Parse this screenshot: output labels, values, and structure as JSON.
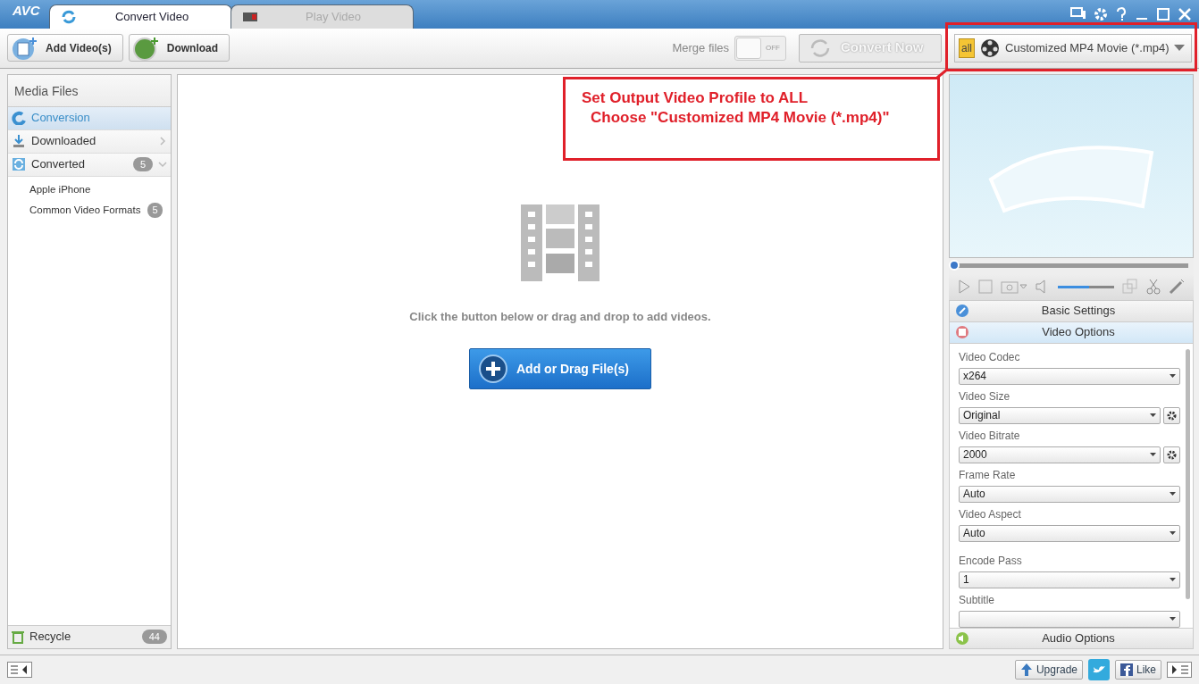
{
  "window": {
    "logo": "AVC"
  },
  "tabs": [
    {
      "label": "Convert Video",
      "selected": true
    },
    {
      "label": "Play Video",
      "selected": false
    }
  ],
  "toolbar": {
    "buttons": [
      "Add Video(s)",
      "Download"
    ],
    "merge": {
      "label": "Merge files",
      "on": false,
      "state_text": "OFF"
    },
    "convert": {
      "label": "Convert Now",
      "disabled": true
    },
    "profile": {
      "badge": "all",
      "value": "Customized MP4 Movie (*.mp4)"
    }
  },
  "annotation": {
    "lines": [
      "Set Output Video Profile to ALL",
      "Choose \"Customized MP4 Movie (*.mp4)\""
    ]
  },
  "sidebar": {
    "title": "Media Files",
    "items": [
      {
        "label": "Conversion",
        "selected": true,
        "kind": "conversion"
      },
      {
        "label": "Downloaded",
        "selected": false,
        "kind": "download",
        "expanded": false
      },
      {
        "label": "Converted",
        "selected": false,
        "kind": "converted",
        "count": "5",
        "expanded": true,
        "children": [
          {
            "label": "Apple iPhone"
          },
          {
            "label": "Common Video Formats",
            "count": "5"
          }
        ]
      }
    ],
    "recycle": {
      "label": "Recycle",
      "count": "44"
    }
  },
  "drop": {
    "hint": "Click the button below or drag and drop to add videos.",
    "button": "Add or Drag File(s)"
  },
  "player": {
    "seek": {
      "level": 0
    },
    "volume": {
      "level": 0.55
    }
  },
  "sections": [
    {
      "label": "Basic Settings",
      "selected": false,
      "kind": "basic"
    },
    {
      "label": "Video Options",
      "selected": true,
      "kind": "video"
    }
  ],
  "settings": [
    {
      "label": "Video Codec",
      "value": "x264",
      "has_gear": false
    },
    {
      "label": "Video Size",
      "value": "Original",
      "has_gear": true
    },
    {
      "label": "Video Bitrate",
      "value": "2000",
      "has_gear": true
    },
    {
      "label": "Frame Rate",
      "value": "Auto",
      "has_gear": false
    },
    {
      "label": "Video Aspect",
      "value": "Auto",
      "has_gear": false
    },
    {
      "label": "Encode Pass",
      "value": "1",
      "has_gear": false,
      "gap": true
    },
    {
      "label": "Subtitle",
      "has_gear": false
    }
  ],
  "audio_section": {
    "label": "Audio Options"
  },
  "status_bar": {
    "upgrade": "Upgrade",
    "like": "Like"
  }
}
